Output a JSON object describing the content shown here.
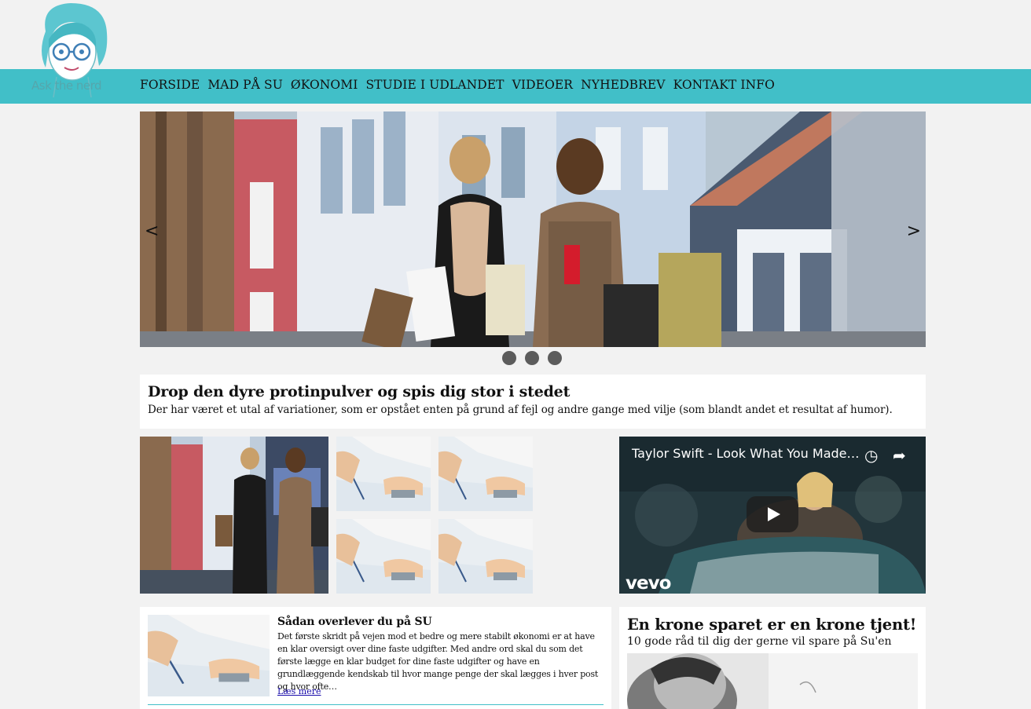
{
  "header": {
    "logo_text": "Ask the nerd",
    "nav": [
      "FORSIDE",
      "MAD PÅ SU",
      "ØKONOMI",
      "STUDIE I UDLANDET",
      "VIDEOER",
      "NYHEDBREV",
      "KONTAKT INFO"
    ]
  },
  "slider": {
    "prev_label": "<",
    "next_label": ">",
    "dot_count": 3
  },
  "banner": {
    "title": "Drop den dyre protinpulver og spis dig stor i stedet",
    "text": "Der har været et utal af variationer, som er opstået enten på grund af fejl og andre gange med vilje (som blandt andet et resultat af humor)."
  },
  "video": {
    "title": "Taylor Swift - Look What You Made…",
    "brand": "vevo"
  },
  "article": {
    "title": "Sådan overlever du på SU",
    "text": "Det første skridt på vejen mod et bedre og mere stabilt økonomi er at have en klar oversigt over dine faste udgifter. Med andre ord skal du som det første lægge en klar budget for dine faste udgifter og have en grundlæggende kendskab til hvor mange penge der skal lægges i hver post og hvor ofte…",
    "link": "Læs mere"
  },
  "side_article": {
    "title": "En krone sparet er en krone tjent!",
    "subtitle": "10 gode råd til dig der gerne vil spare på Su'en"
  },
  "colors": {
    "accent": "#41bfc8",
    "background": "#f2f2f2"
  }
}
